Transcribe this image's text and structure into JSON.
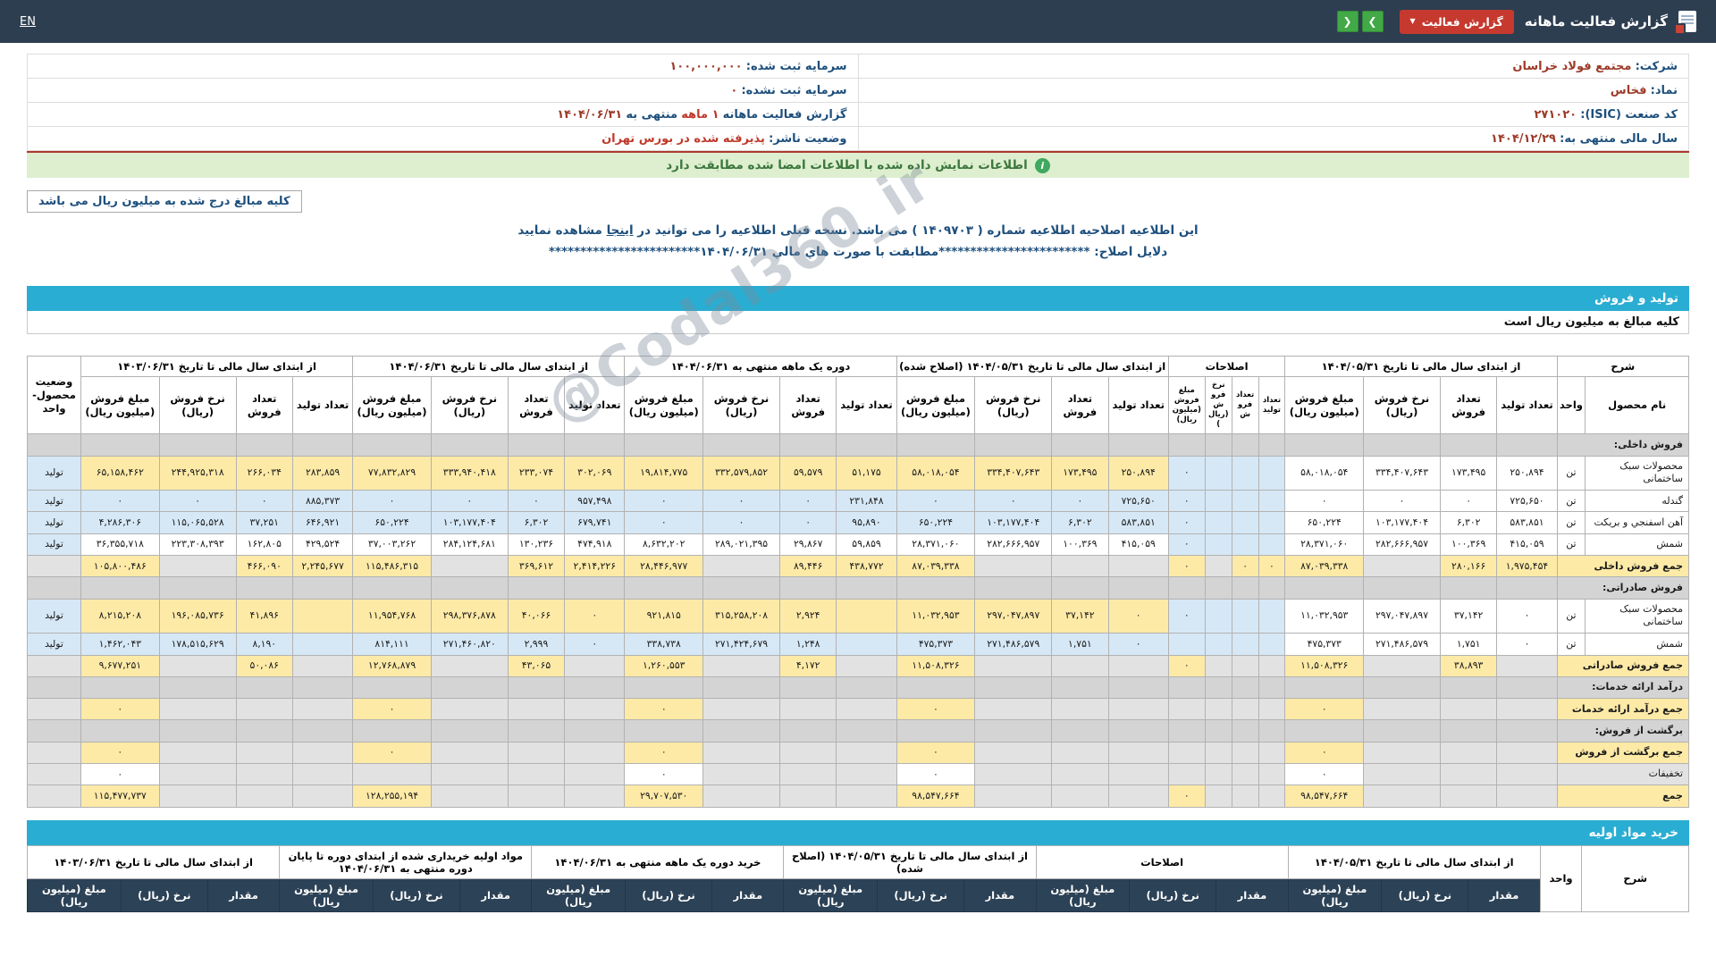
{
  "topbar": {
    "en_label": "EN",
    "title": "گزارش فعالیت ماهانه",
    "badge_label": "گزارش فعالیت"
  },
  "icons": {
    "caret_down": "▼",
    "chevron_left": "❮",
    "chevron_right": "❯",
    "info": "i"
  },
  "watermark": "@Codal360_ir",
  "info": {
    "company_label": "شرکت:",
    "company_value": "مجتمع فولاد خراسان",
    "capital_reg_label": "سرمایه ثبت شده:",
    "capital_reg_value": "۱۰۰,۰۰۰,۰۰۰",
    "symbol_label": "نماد:",
    "symbol_value": "فخاس",
    "capital_unreg_label": "سرمایه ثبت نشده:",
    "capital_unreg_value": "۰",
    "isic_label": "کد صنعت (ISIC):",
    "isic_value": "۲۷۱۰۲۰",
    "report_label": "گزارش فعالیت ماهانه",
    "report_period": "۱ ماهه",
    "report_until": "منتهی به",
    "report_date": "۱۴۰۴/۰۶/۳۱",
    "fiscal_label": "سال مالی منتهی به:",
    "fiscal_value": "۱۴۰۴/۱۲/۲۹",
    "status_label": "وضعیت ناشر:",
    "status_value": "پذیرفته شده در بورس تهران"
  },
  "green_bar": {
    "text": "اطلاعات نمایش داده شده با اطلاعات امضا شده مطابقت دارد"
  },
  "amounts_note": "کلیه مبالغ درج شده به میلیون ریال می باشد",
  "correction_notice": {
    "part1": "این اطلاعیه اصلاحیه اطلاعیه شماره (",
    "number": "۱۴۰۹۷۰۳",
    "part2": ") می باشد. نسخه قبلی اطلاعیه را می توانید در",
    "link": "اینجا",
    "part3": "مشاهده نمایید"
  },
  "correction_reasons": {
    "label": "دلایل اصلاح:",
    "text": "************************مطابقت با صورت هاي مالي ۱۴۰۴/۰۶/۳۱************************"
  },
  "production_table": {
    "title_bar": "تولید و فروش",
    "note_row": "کلیه مبالغ به میلیون ریال است",
    "header": {
      "desc": "شرح",
      "product": "نام محصول",
      "unit": "واحد",
      "status": "وضعیت محصول-واحد",
      "groups": [
        "از ابتدای سال مالی تا تاریخ ۱۴۰۴/۰۵/۳۱",
        "اصلاحات",
        "از ابتدای سال مالی تا تاریخ ۱۴۰۴/۰۵/۳۱ (اصلاح شده)",
        "دوره یک ماهه منتهی به ۱۴۰۴/۰۶/۳۱",
        "از ابتدای سال مالی تا تاریخ ۱۴۰۴/۰۶/۳۱",
        "از ابتدای سال مالی تا تاریخ ۱۴۰۳/۰۶/۳۱"
      ],
      "subcols": [
        "تعداد تولید",
        "تعداد فروش",
        "نرخ فروش (ریال)",
        "مبلغ فروش (میلیون ریال)"
      ]
    },
    "rows": [
      {
        "type": "section",
        "label": "فروش داخلی:"
      },
      {
        "type": "data",
        "tone": "y",
        "label": "محصولات سبک ساختمانی",
        "unit": "تن",
        "status": "تولید",
        "cells": [
          "۲۵۰,۸۹۴",
          "۱۷۳,۴۹۵",
          "۳۳۴,۴۰۷,۶۴۳",
          "۵۸,۰۱۸,۰۵۴",
          "",
          "",
          "",
          "۰",
          "۲۵۰,۸۹۴",
          "۱۷۳,۴۹۵",
          "۳۳۴,۴۰۷,۶۴۳",
          "۵۸,۰۱۸,۰۵۴",
          "۵۱,۱۷۵",
          "۵۹,۵۷۹",
          "۳۳۲,۵۷۹,۸۵۲",
          "۱۹,۸۱۴,۷۷۵",
          "۳۰۲,۰۶۹",
          "۲۳۳,۰۷۴",
          "۳۳۳,۹۴۰,۴۱۸",
          "۷۷,۸۳۲,۸۲۹",
          "۲۸۳,۸۵۹",
          "۲۶۶,۰۳۴",
          "۲۴۴,۹۲۵,۳۱۸",
          "۶۵,۱۵۸,۴۶۲"
        ]
      },
      {
        "type": "data",
        "tone": "b",
        "label": "گندله",
        "unit": "تن",
        "status": "تولید",
        "cells": [
          "۷۲۵,۶۵۰",
          "۰",
          "۰",
          "۰",
          "",
          "",
          "",
          "۰",
          "۷۲۵,۶۵۰",
          "۰",
          "۰",
          "۰",
          "۲۳۱,۸۴۸",
          "۰",
          "۰",
          "۰",
          "۹۵۷,۴۹۸",
          "۰",
          "۰",
          "۰",
          "۸۸۵,۳۷۳",
          "۰",
          "۰",
          "۰"
        ]
      },
      {
        "type": "data",
        "tone": "b",
        "label": "آهن اسفنجي و بریکت",
        "unit": "تن",
        "status": "تولید",
        "cells": [
          "۵۸۳,۸۵۱",
          "۶,۳۰۲",
          "۱۰۳,۱۷۷,۴۰۴",
          "۶۵۰,۲۲۴",
          "",
          "",
          "",
          "۰",
          "۵۸۳,۸۵۱",
          "۶,۳۰۲",
          "۱۰۳,۱۷۷,۴۰۴",
          "۶۵۰,۲۲۴",
          "۹۵,۸۹۰",
          "۰",
          "۰",
          "۰",
          "۶۷۹,۷۴۱",
          "۶,۳۰۲",
          "۱۰۳,۱۷۷,۴۰۴",
          "۶۵۰,۲۲۴",
          "۶۴۶,۹۲۱",
          "۳۷,۲۵۱",
          "۱۱۵,۰۶۵,۵۲۸",
          "۴,۲۸۶,۳۰۶"
        ]
      },
      {
        "type": "data",
        "tone": "w",
        "label": "شمش",
        "unit": "تن",
        "status": "تولید",
        "cells": [
          "۴۱۵,۰۵۹",
          "۱۰۰,۳۶۹",
          "۲۸۲,۶۶۶,۹۵۷",
          "۲۸,۳۷۱,۰۶۰",
          "",
          "",
          "",
          "۰",
          "۴۱۵,۰۵۹",
          "۱۰۰,۳۶۹",
          "۲۸۲,۶۶۶,۹۵۷",
          "۲۸,۳۷۱,۰۶۰",
          "۵۹,۸۵۹",
          "۲۹,۸۶۷",
          "۲۸۹,۰۲۱,۳۹۵",
          "۸,۶۳۲,۲۰۲",
          "۴۷۴,۹۱۸",
          "۱۳۰,۲۳۶",
          "۲۸۴,۱۲۴,۶۸۱",
          "۳۷,۰۰۳,۲۶۲",
          "۴۲۹,۵۲۴",
          "۱۶۲,۸۰۵",
          "۲۲۳,۳۰۸,۳۹۳",
          "۳۶,۳۵۵,۷۱۸"
        ]
      },
      {
        "type": "sum",
        "label": "جمع فروش داخلی",
        "cells": [
          "۱,۹۷۵,۴۵۴",
          "۲۸۰,۱۶۶",
          "",
          "۸۷,۰۳۹,۳۳۸",
          "۰",
          "۰",
          "",
          "۰",
          "",
          "",
          "",
          "۸۷,۰۳۹,۳۳۸",
          "۴۳۸,۷۷۲",
          "۸۹,۴۴۶",
          "",
          "۲۸,۴۴۶,۹۷۷",
          "۲,۴۱۴,۲۲۶",
          "۳۶۹,۶۱۲",
          "",
          "۱۱۵,۴۸۶,۳۱۵",
          "۲,۲۴۵,۶۷۷",
          "۴۶۶,۰۹۰",
          "",
          "۱۰۵,۸۰۰,۴۸۶"
        ]
      },
      {
        "type": "section",
        "label": "فروش صادراتی:"
      },
      {
        "type": "data",
        "tone": "y",
        "label": "محصولات سبک ساختمانی",
        "unit": "تن",
        "status": "تولید",
        "cells": [
          "۰",
          "۳۷,۱۴۲",
          "۲۹۷,۰۴۷,۸۹۷",
          "۱۱,۰۳۲,۹۵۳",
          "",
          "",
          "",
          "۰",
          "۰",
          "۳۷,۱۴۲",
          "۲۹۷,۰۴۷,۸۹۷",
          "۱۱,۰۳۲,۹۵۳",
          "",
          "۲,۹۲۴",
          "۳۱۵,۲۵۸,۲۰۸",
          "۹۲۱,۸۱۵",
          "۰",
          "۴۰,۰۶۶",
          "۲۹۸,۳۷۶,۸۷۸",
          "۱۱,۹۵۴,۷۶۸",
          "",
          "۴۱,۸۹۶",
          "۱۹۶,۰۸۵,۷۳۶",
          "۸,۲۱۵,۲۰۸"
        ]
      },
      {
        "type": "data",
        "tone": "b",
        "label": "شمش",
        "unit": "تن",
        "status": "تولید",
        "cells": [
          "۰",
          "۱,۷۵۱",
          "۲۷۱,۴۸۶,۵۷۹",
          "۴۷۵,۳۷۳",
          "",
          "",
          "",
          "",
          "۰",
          "۱,۷۵۱",
          "۲۷۱,۴۸۶,۵۷۹",
          "۴۷۵,۳۷۳",
          "",
          "۱,۲۴۸",
          "۲۷۱,۴۲۴,۶۷۹",
          "۳۳۸,۷۳۸",
          "۰",
          "۲,۹۹۹",
          "۲۷۱,۴۶۰,۸۲۰",
          "۸۱۴,۱۱۱",
          "",
          "۸,۱۹۰",
          "۱۷۸,۵۱۵,۶۲۹",
          "۱,۴۶۲,۰۴۳"
        ]
      },
      {
        "type": "sum",
        "label": "جمع فروش صادراتی",
        "cells": [
          "",
          "۳۸,۸۹۳",
          "",
          "۱۱,۵۰۸,۳۲۶",
          "",
          "",
          "",
          "۰",
          "",
          "",
          "",
          "۱۱,۵۰۸,۳۲۶",
          "",
          "۴,۱۷۲",
          "",
          "۱,۲۶۰,۵۵۳",
          "",
          "۴۳,۰۶۵",
          "",
          "۱۲,۷۶۸,۸۷۹",
          "",
          "۵۰,۰۸۶",
          "",
          "۹,۶۷۷,۲۵۱"
        ]
      },
      {
        "type": "section",
        "label": "درآمد ارائه خدمات:"
      },
      {
        "type": "sum",
        "label": "جمع درآمد ارائه خدمات",
        "cells": [
          "",
          "",
          "",
          "۰",
          "",
          "",
          "",
          "",
          "",
          "",
          "",
          "۰",
          "",
          "",
          "",
          "۰",
          "",
          "",
          "",
          "۰",
          "",
          "",
          "",
          "۰"
        ]
      },
      {
        "type": "section",
        "label": "برگشت از فروش:"
      },
      {
        "type": "sum",
        "label": "جمع برگشت از فروش",
        "cells": [
          "",
          "",
          "",
          "۰",
          "",
          "",
          "",
          "",
          "",
          "",
          "",
          "۰",
          "",
          "",
          "",
          "۰",
          "",
          "",
          "",
          "۰",
          "",
          "",
          "",
          "۰"
        ]
      },
      {
        "type": "disc",
        "label": "تخفیفات",
        "cells": [
          "",
          "",
          "",
          "۰",
          "",
          "",
          "",
          "",
          "",
          "",
          "",
          "۰",
          "",
          "",
          "",
          "۰",
          "",
          "",
          "",
          "",
          "",
          "",
          "",
          "۰"
        ]
      },
      {
        "type": "sum",
        "label": "جمع",
        "cells": [
          "",
          "",
          "",
          "۹۸,۵۴۷,۶۶۴",
          "",
          "",
          "",
          "۰",
          "",
          "",
          "",
          "۹۸,۵۴۷,۶۶۴",
          "",
          "",
          "",
          "۲۹,۷۰۷,۵۳۰",
          "",
          "",
          "",
          "۱۲۸,۲۵۵,۱۹۴",
          "",
          "",
          "",
          "۱۱۵,۴۷۷,۷۳۷"
        ]
      }
    ]
  },
  "purchase_table": {
    "title_bar": "خرید مواد اولیه",
    "header": {
      "desc": "شرح",
      "unit": "واحد",
      "groups": [
        "از ابتدای سال مالی تا تاریخ ۱۴۰۴/۰۵/۳۱",
        "اصلاحات",
        "از ابتدای سال مالی تا تاریخ ۱۴۰۴/۰۵/۳۱ (اصلاح شده)",
        "خرید دوره یک ماهه منتهی به ۱۴۰۴/۰۶/۳۱",
        "مواد اولیه خریداری شده از ابتدای دوره تا پایان دوره منتهی به ۱۴۰۴/۰۶/۳۱",
        "از ابتدای سال مالی تا تاریخ ۱۴۰۳/۰۶/۳۱"
      ],
      "subcols": [
        "مقدار",
        "نرخ (ریال)",
        "مبلغ (میلیون ریال)"
      ]
    }
  }
}
